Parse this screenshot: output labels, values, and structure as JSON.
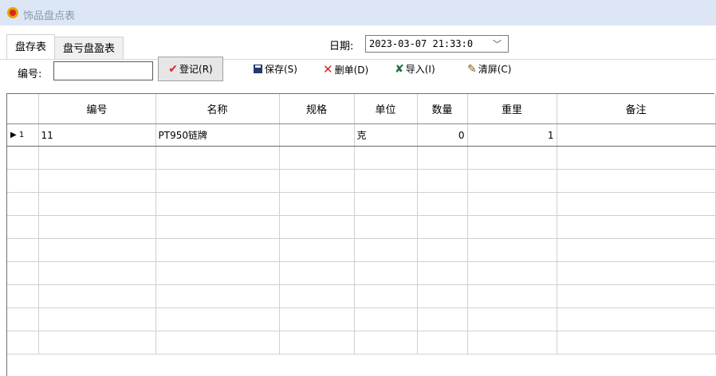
{
  "window": {
    "title": "饰品盘点表"
  },
  "tabs": [
    {
      "label": "盘存表"
    },
    {
      "label": "盘亏盘盈表"
    }
  ],
  "date": {
    "label": "日期:",
    "value": "2023-03-07 21:33:0"
  },
  "code": {
    "label": "编号:",
    "value": ""
  },
  "toolbar": {
    "register_label": "登记(R)",
    "save_label": "保存(S)",
    "delete_label": "删单(D)",
    "import_label": "导入(I)",
    "clear_label": "清屏(C)"
  },
  "grid": {
    "columns": [
      "编号",
      "名称",
      "规格",
      "单位",
      "数量",
      "重里",
      "备注"
    ],
    "rows": [
      {
        "indicator": "▶ 1",
        "code": "11",
        "name": "PT950链牌",
        "spec": "",
        "unit": "克",
        "qty": "0",
        "weight": "1",
        "note": ""
      }
    ]
  },
  "colors": {
    "titlebar": "#dce6f4",
    "accent_red": "#e02020"
  }
}
